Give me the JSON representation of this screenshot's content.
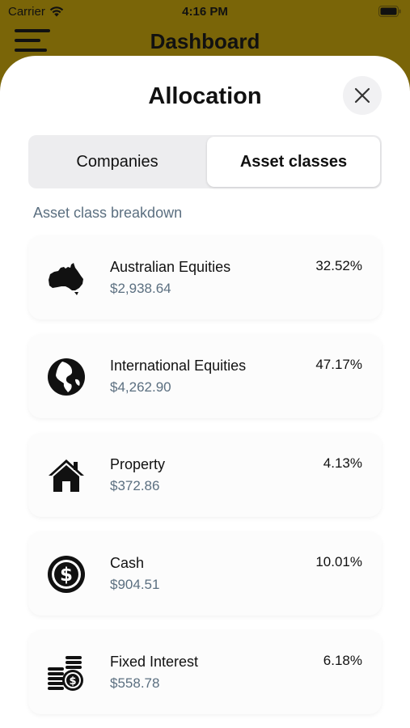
{
  "status_bar": {
    "carrier": "Carrier",
    "time": "4:16 PM"
  },
  "background_header": {
    "title": "Dashboard"
  },
  "sheet": {
    "title": "Allocation",
    "tabs": [
      {
        "label": "Companies",
        "selected": false
      },
      {
        "label": "Asset classes",
        "selected": true
      }
    ],
    "section_label": "Asset class breakdown",
    "items": [
      {
        "icon": "australia-map-icon",
        "name": "Australian Equities",
        "amount": "$2,938.64",
        "percent": "32.52%"
      },
      {
        "icon": "globe-icon",
        "name": "International Equities",
        "amount": "$4,262.90",
        "percent": "47.17%"
      },
      {
        "icon": "house-icon",
        "name": "Property",
        "amount": "$372.86",
        "percent": "4.13%"
      },
      {
        "icon": "dollar-coin-icon",
        "name": "Cash",
        "amount": "$904.51",
        "percent": "10.01%"
      },
      {
        "icon": "coin-stack-icon",
        "name": "Fixed Interest",
        "amount": "$558.78",
        "percent": "6.18%"
      }
    ]
  },
  "colors": {
    "header_bg": "#7a6508",
    "secondary_text": "#5b6f80",
    "segment_bg": "#ededef"
  }
}
